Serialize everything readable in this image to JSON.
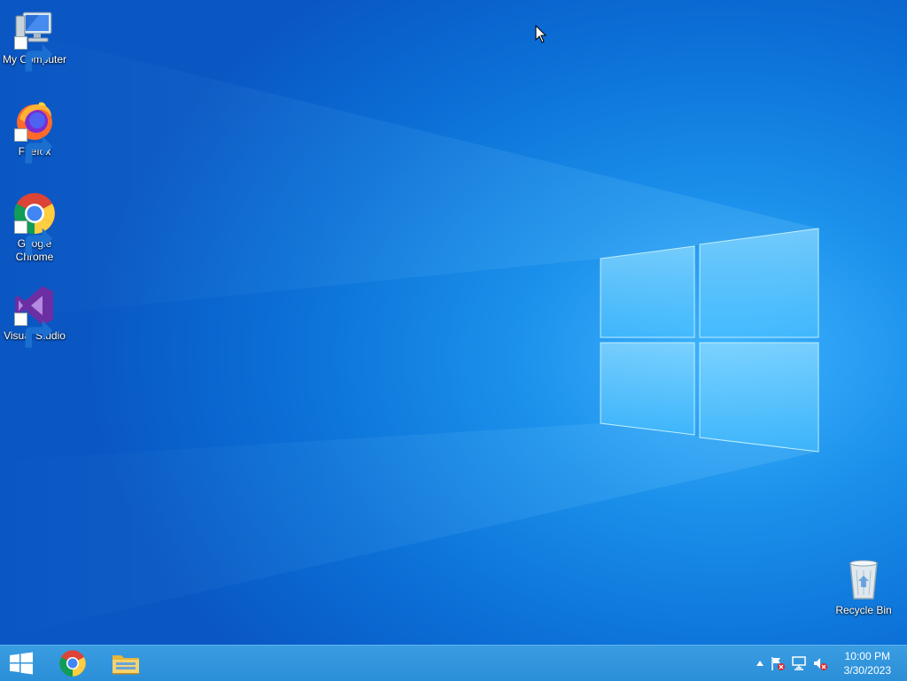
{
  "desktop": {
    "icons": [
      {
        "label": "My Computer",
        "icon": "computer-icon"
      },
      {
        "label": "Firefox",
        "icon": "firefox-icon"
      },
      {
        "label": "Google Chrome",
        "icon": "chrome-icon"
      },
      {
        "label": "Visual Studio",
        "icon": "visual-studio-icon"
      },
      {
        "label": "Recycle Bin",
        "icon": "recycle-bin-icon"
      }
    ]
  },
  "taskbar": {
    "start": "windows-logo-icon",
    "pinned": [
      "chrome-icon",
      "file-explorer-icon"
    ],
    "tray": [
      "show-hidden-icons-icon",
      "action-center-flag-icon",
      "network-icon",
      "volume-muted-icon"
    ],
    "clock": {
      "time": "10:00 PM",
      "date": "3/30/2023"
    }
  },
  "colors": {
    "accent": "#1a8fea",
    "taskbar": "#2b8fd8"
  }
}
